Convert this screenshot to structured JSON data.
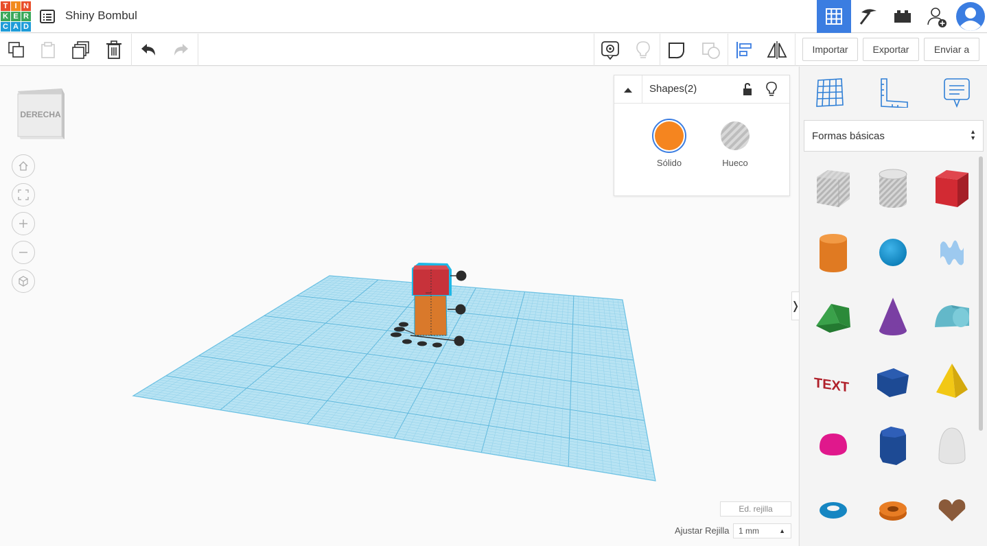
{
  "app": {
    "logo_letters": [
      "T",
      "I",
      "N",
      "K",
      "E",
      "R",
      "C",
      "A",
      "D"
    ],
    "logo_colors": [
      "#e84e2a",
      "#f28a1d",
      "#e84e2a",
      "#3aa85a",
      "#3aa85a",
      "#3aa85a",
      "#1f9cd8",
      "#1f9cd8",
      "#1f9cd8"
    ],
    "project_title": "Shiny Bombul"
  },
  "toolbar": {
    "import_label": "Importar",
    "export_label": "Exportar",
    "send_label": "Enviar a"
  },
  "viewcube": {
    "face_label": "DERECHA"
  },
  "inspector": {
    "title": "Shapes(2)",
    "solid_label": "Sólido",
    "hole_label": "Hueco",
    "solid_color": "#f5851f"
  },
  "grid": {
    "edit_label": "Ed. rejilla",
    "snap_label": "Ajustar Rejilla",
    "snap_value": "1 mm"
  },
  "sidebar": {
    "library": "Formas básicas",
    "shapes": [
      "Caja Agujero",
      "Cilindro Agujero",
      "Caja",
      "Cilindro",
      "Esfera",
      "Garabato",
      "Techo",
      "Cono",
      "Techo redondo",
      "Texto",
      "Prisma",
      "Pirámide",
      "Media esfera",
      "Polígono",
      "Paraboloide",
      "Toroide",
      "Tubo",
      "Corazón"
    ]
  },
  "colors": {
    "accent": "#3b7de1",
    "grid": "#8fd0ea",
    "selected_top": "#c7323a",
    "selected_bottom": "#d9792b"
  }
}
